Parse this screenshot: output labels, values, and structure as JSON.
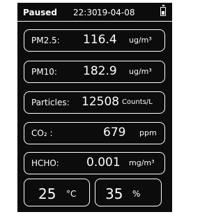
{
  "status": {
    "state": "Paused",
    "time": "22:30",
    "date": "19-04-08",
    "battery_icon": "battery-icon"
  },
  "readings": [
    {
      "label": "PM2.5:",
      "value": "116.4",
      "unit": "ug/m³"
    },
    {
      "label": "PM10:",
      "value": "182.9",
      "unit": "ug/m³"
    },
    {
      "label": "Particles:",
      "value": "12508",
      "unit": "Counts/L"
    },
    {
      "label": "CO₂ :",
      "value": "679",
      "unit": "ppm"
    },
    {
      "label": "HCHO:",
      "value": "0.001",
      "unit": "mg/m³"
    }
  ],
  "temperature": {
    "value": "25",
    "unit": "°C"
  },
  "humidity": {
    "value": "35",
    "unit": "%"
  }
}
